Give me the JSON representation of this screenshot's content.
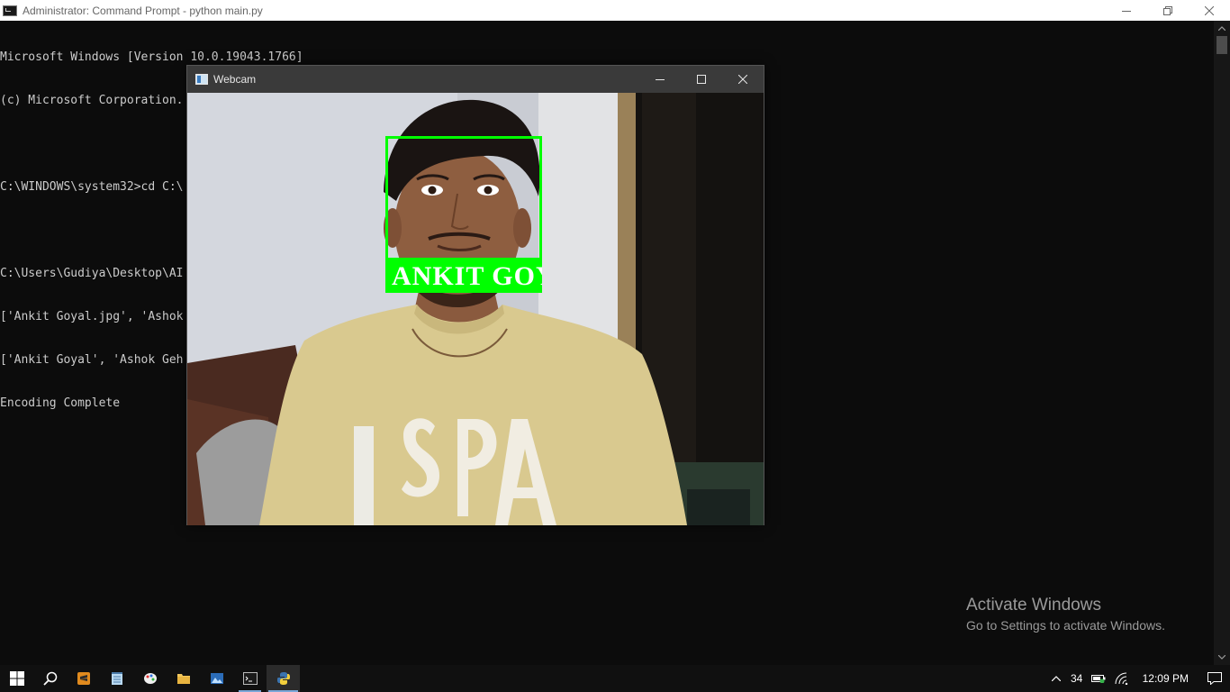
{
  "cmd": {
    "title": "Administrator: Command Prompt - python  main.py",
    "lines": [
      "Microsoft Windows [Version 10.0.19043.1766]",
      "(c) Microsoft Corporation. All rights reserved.",
      "",
      "C:\\WINDOWS\\system32>cd C:\\",
      "",
      "C:\\Users\\Gudiya\\Desktop\\AI",
      "['Ankit Goyal.jpg', 'Ashok",
      "['Ankit Goyal', 'Ashok Geh",
      "Encoding Complete"
    ]
  },
  "webcam": {
    "title": "Webcam",
    "detected_name": "ANKIT GOYAL",
    "box_color": "#00ff00"
  },
  "watermark": {
    "title": "Activate Windows",
    "subtitle": "Go to Settings to activate Windows."
  },
  "taskbar": {
    "pinned": [
      "start-icon",
      "search-icon",
      "sublime-text-icon",
      "notepad-icon",
      "paint-icon",
      "file-explorer-icon",
      "photos-icon",
      "command-prompt-icon",
      "python-icon"
    ],
    "tray": {
      "temperature": "34",
      "clock": "12:09 PM"
    }
  }
}
